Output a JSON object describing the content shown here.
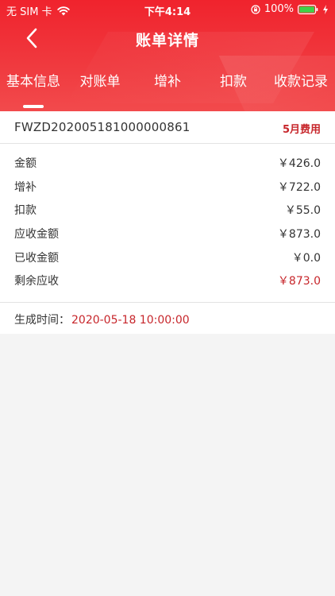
{
  "status_bar": {
    "carrier": "无 SIM 卡",
    "time": "下午4:14",
    "battery": "100%"
  },
  "nav": {
    "title": "账单详情"
  },
  "tabs": [
    {
      "label": "基本信息",
      "active": true
    },
    {
      "label": "对账单",
      "active": false
    },
    {
      "label": "增补",
      "active": false
    },
    {
      "label": "扣款",
      "active": false
    },
    {
      "label": "收款记录",
      "active": false
    }
  ],
  "bill": {
    "number": "FWZD202005181000000861",
    "month": "5月费用"
  },
  "amounts": [
    {
      "label": "金额",
      "value": "￥426.0"
    },
    {
      "label": "增补",
      "value": "￥722.0"
    },
    {
      "label": "扣款",
      "value": "￥55.0"
    },
    {
      "label": "应收金额",
      "value": "￥873.0"
    },
    {
      "label": "已收金额",
      "value": "￥0.0"
    },
    {
      "label": "剩余应收",
      "value": "￥873.0"
    }
  ],
  "generated": {
    "label": "生成时间：",
    "value": "2020-05-18 10:00:00"
  },
  "colors": {
    "header_red": "#f0232d",
    "accent_red": "#c7262b",
    "background": "#f4f4f4"
  },
  "icons": {
    "back": "chevron-left-icon",
    "wifi": "wifi-icon",
    "lock": "orientation-lock-icon",
    "battery": "battery-icon",
    "charging": "charging-bolt-icon"
  }
}
